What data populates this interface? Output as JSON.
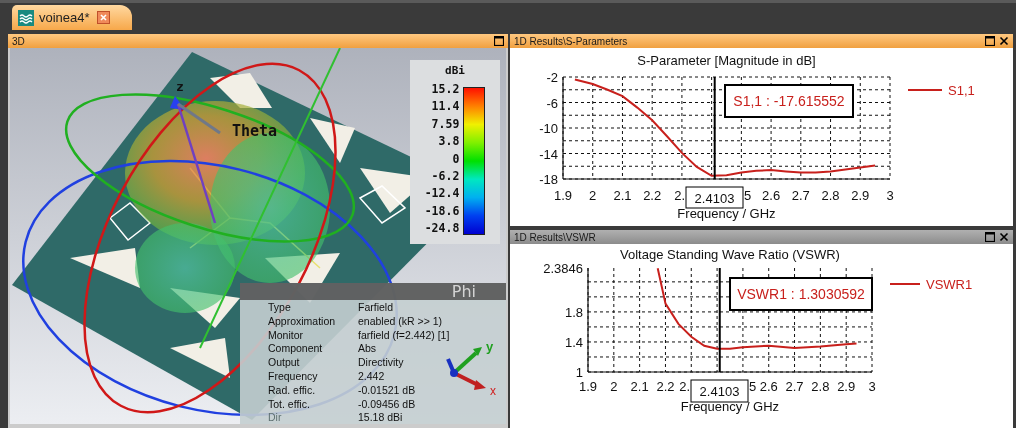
{
  "tabs": [
    {
      "label": "voinea4*",
      "selected": true
    }
  ],
  "view3d": {
    "title": "3D",
    "active": true,
    "axis_label": "z",
    "angle_label": "Theta",
    "phi_label": "Phi",
    "triad": {
      "y": "y",
      "x": "x"
    },
    "colorbar": {
      "unit": "dBi",
      "ticks": [
        "15.2",
        "11.4",
        "7.59",
        "3.8",
        "0",
        "-6.2",
        "-12.4",
        "-18.6",
        "-24.8"
      ]
    },
    "info": [
      {
        "label": "Type",
        "value": "Farfield"
      },
      {
        "label": "Approximation",
        "value": "enabled (kR >> 1)"
      },
      {
        "label": "Monitor",
        "value": "farfield (f=2.442) [1]"
      },
      {
        "label": "Component",
        "value": "Abs"
      },
      {
        "label": "Output",
        "value": "Directivity"
      },
      {
        "label": "Frequency",
        "value": "2.442"
      },
      {
        "label": "Rad. effic.",
        "value": "-0.01521 dB"
      },
      {
        "label": "Tot. effic.",
        "value": "-0.09456 dB"
      },
      {
        "label": "Dir",
        "value": "15.18 dBi"
      }
    ]
  },
  "results": [
    {
      "title": "1D Results\\S-Parameters",
      "active": true,
      "partial_tick_labels": [
        "2.",
        "5"
      ],
      "chart_data": {
        "type": "line",
        "title": "S-Parameter [Magnitude in dB]",
        "xlabel": "Frequency / GHz",
        "xlim": [
          1.9,
          3
        ],
        "ylim": [
          -18,
          -2
        ],
        "grid": true,
        "xticks": [
          1.9,
          2,
          2.1,
          2.2,
          2.6,
          2.7,
          2.8,
          2.9,
          3
        ],
        "yticks": [
          -2,
          -6,
          -10,
          -14,
          -18
        ],
        "x": [
          1.94,
          2.0,
          2.05,
          2.1,
          2.15,
          2.2,
          2.25,
          2.3,
          2.35,
          2.4,
          2.45,
          2.5,
          2.55,
          2.6,
          2.65,
          2.7,
          2.75,
          2.8,
          2.85,
          2.9,
          2.95
        ],
        "series": [
          {
            "name": "S1,1",
            "color": "#c8201c",
            "values": [
              -2.4,
              -3.1,
              -4.0,
              -5.0,
              -6.8,
              -8.8,
              -11.3,
              -13.9,
              -16.1,
              -17.5,
              -17.4,
              -17.0,
              -16.7,
              -16.6,
              -16.8,
              -17.0,
              -17.0,
              -16.8,
              -16.5,
              -16.2,
              -15.9
            ]
          }
        ],
        "ref_lines": [
          {
            "axis": "x",
            "value": 2.4103,
            "label": "2.4103"
          }
        ],
        "annotations": [
          {
            "text": "S1,1 : -17.615552"
          }
        ]
      }
    },
    {
      "title": "1D Results\\VSWR",
      "active": false,
      "partial_tick_labels": [
        "2.",
        "5"
      ],
      "chart_data": {
        "type": "line",
        "title": "Voltage Standing Wave Ratio (VSWR)",
        "xlabel": "Frequency / GHz",
        "xlim": [
          1.9,
          3
        ],
        "ylim": [
          1,
          2.3846
        ],
        "grid": true,
        "xticks": [
          1.9,
          2,
          2.1,
          2.2,
          2.6,
          2.7,
          2.8,
          2.9,
          3
        ],
        "yticks": [
          1,
          1.4,
          1.8,
          2.3846
        ],
        "x": [
          2.17,
          2.2,
          2.25,
          2.3,
          2.35,
          2.4,
          2.45,
          2.5,
          2.6,
          2.7,
          2.8,
          2.9,
          2.94
        ],
        "series": [
          {
            "name": "VSWR1",
            "color": "#c8201c",
            "values": [
              2.38,
              1.91,
              1.64,
              1.47,
              1.35,
              1.31,
              1.31,
              1.33,
              1.35,
              1.32,
              1.34,
              1.37,
              1.38
            ]
          }
        ],
        "ref_lines": [
          {
            "axis": "x",
            "value": 2.4103,
            "label": "2.4103"
          }
        ],
        "annotations": [
          {
            "text": "VSWR1 : 1.3030592"
          }
        ]
      }
    }
  ]
}
